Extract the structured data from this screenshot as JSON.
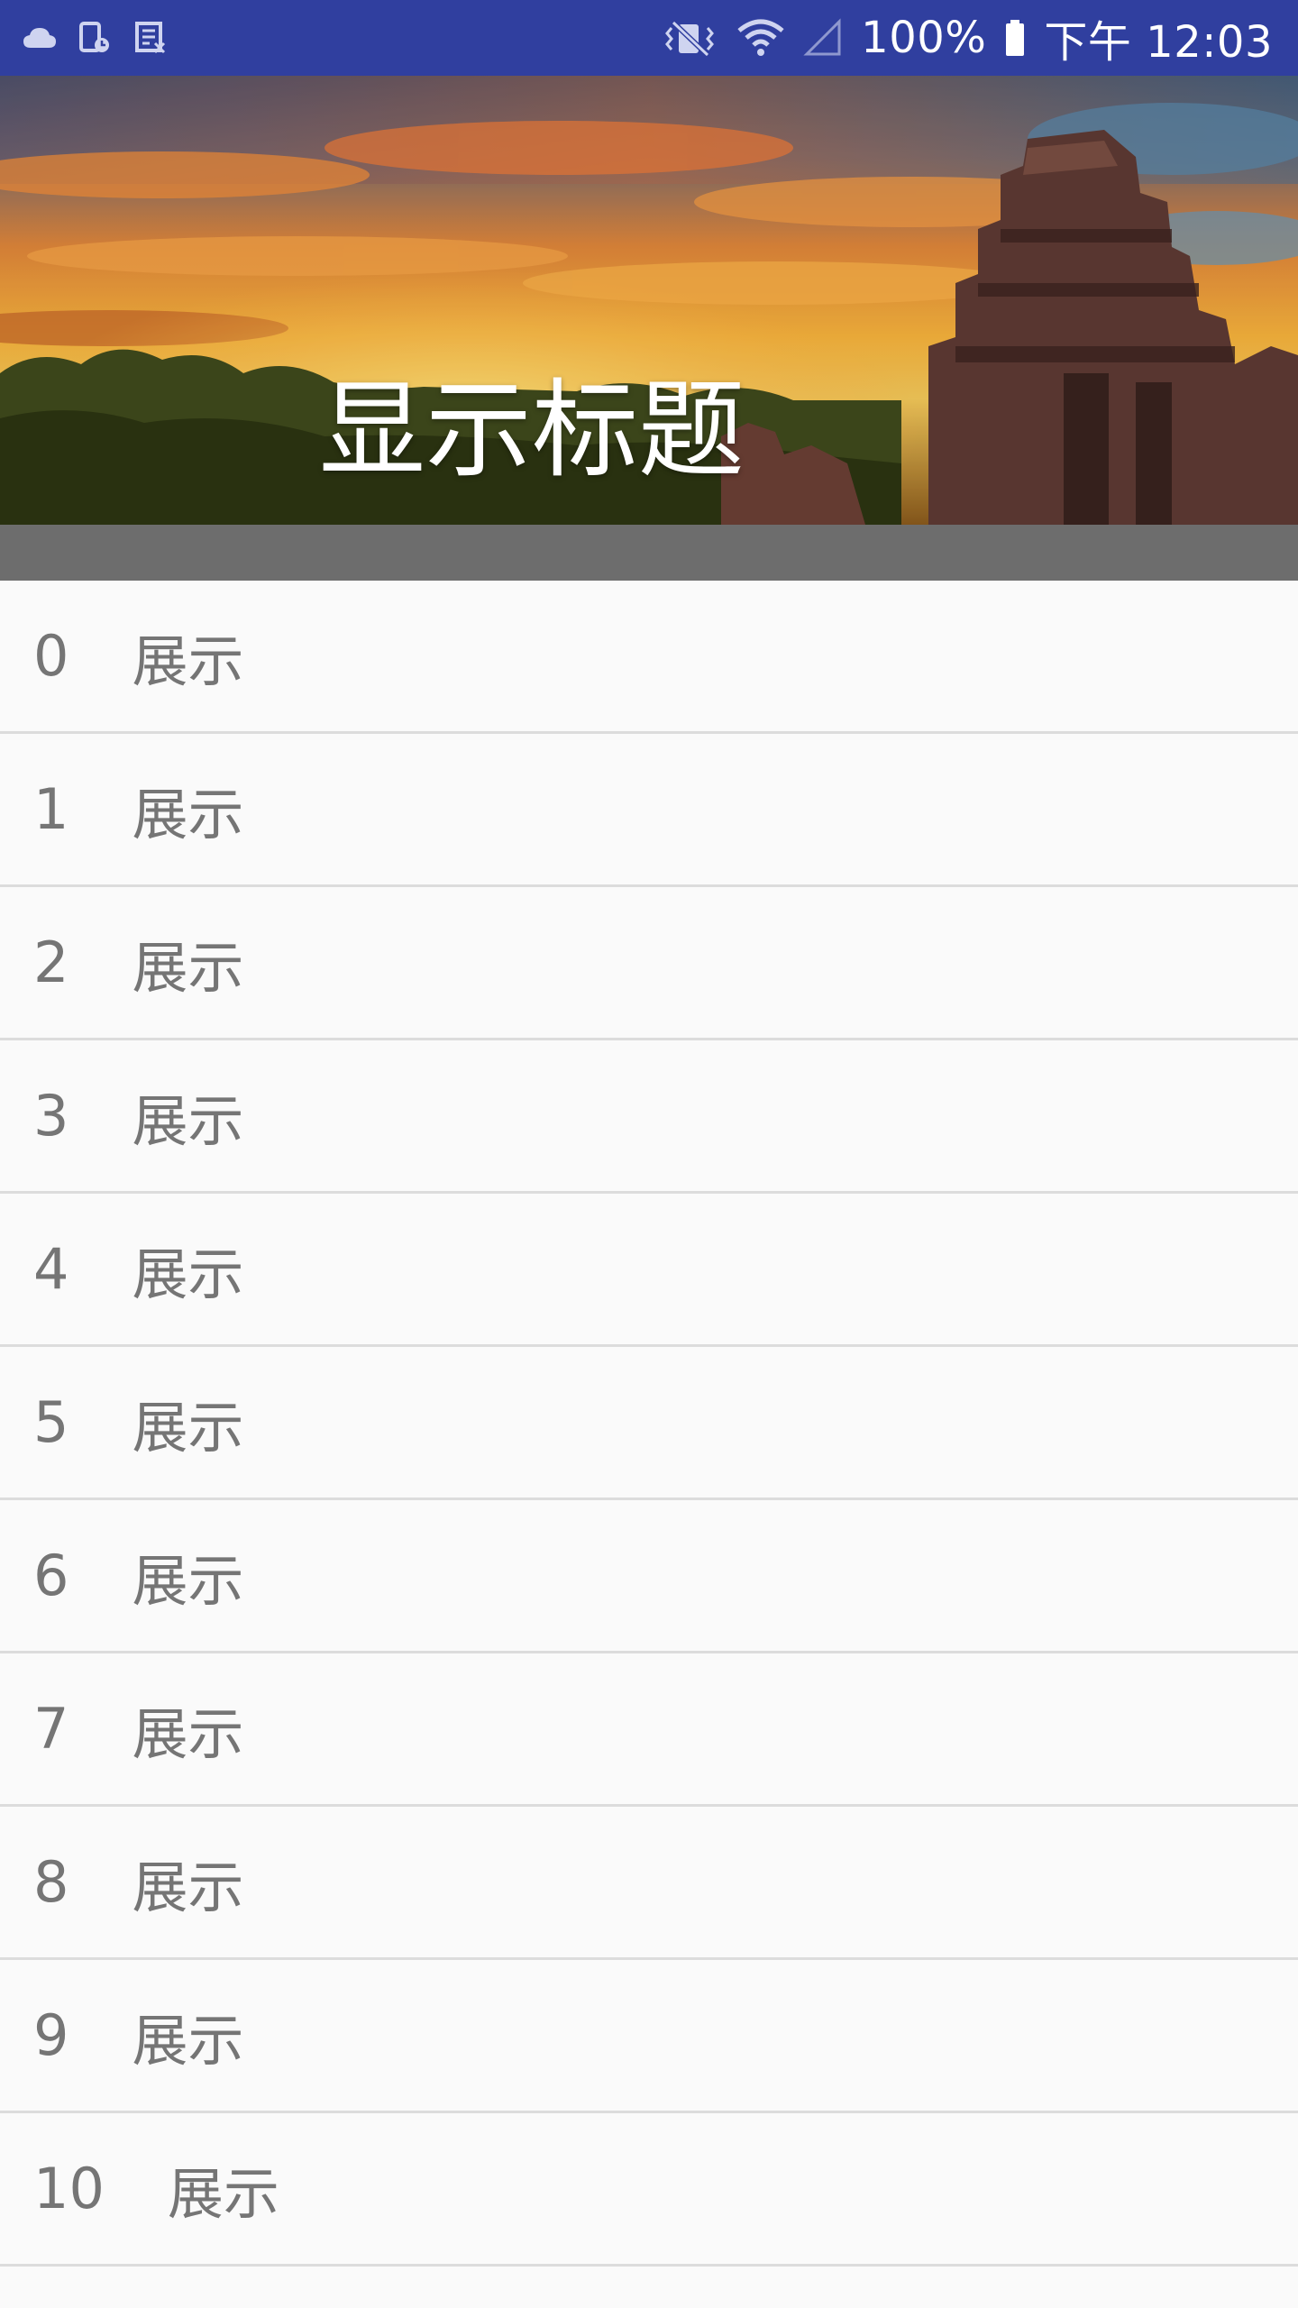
{
  "status_bar": {
    "left_icons": [
      "cloud-icon",
      "sim-card-icon",
      "screenshot-icon"
    ],
    "right_icons": [
      "vibrate-icon",
      "wifi-icon",
      "signal-icon",
      "battery-icon"
    ],
    "battery_text": "100%",
    "time": "下午 12:03",
    "background": "#303f9f"
  },
  "header": {
    "title": "显示标题",
    "image": "sunset-temple-image"
  },
  "list": {
    "items": [
      {
        "index": "0",
        "label": "展示"
      },
      {
        "index": "1",
        "label": "展示"
      },
      {
        "index": "2",
        "label": "展示"
      },
      {
        "index": "3",
        "label": "展示"
      },
      {
        "index": "4",
        "label": "展示"
      },
      {
        "index": "5",
        "label": "展示"
      },
      {
        "index": "6",
        "label": "展示"
      },
      {
        "index": "7",
        "label": "展示"
      },
      {
        "index": "8",
        "label": "展示"
      },
      {
        "index": "9",
        "label": "展示"
      },
      {
        "index": "10",
        "label": "展示"
      }
    ]
  },
  "colors": {
    "status_bar": "#303f9f",
    "band": "#6d6d6d",
    "list_text": "#757575",
    "divider": "#dcdcdc",
    "list_background": "#fafafa"
  }
}
